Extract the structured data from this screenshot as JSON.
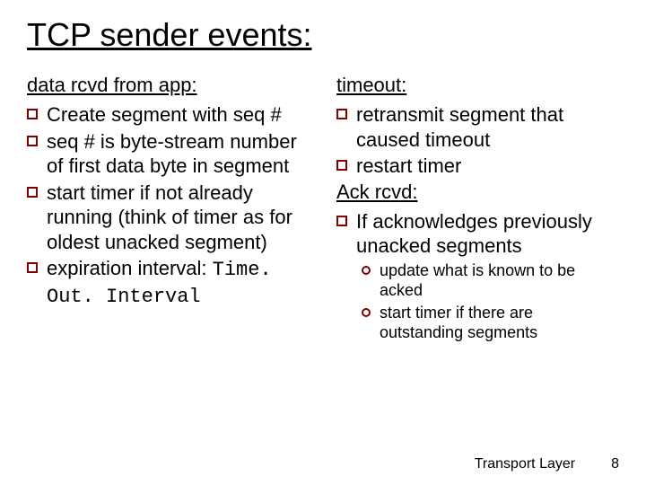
{
  "title": "TCP sender events:",
  "left": {
    "heading": "data rcvd from app:",
    "b1": "Create segment with seq #",
    "b2": "seq # is byte-stream number of first data byte in  segment",
    "b3": "start timer if not already running (think of timer as for oldest unacked segment)",
    "b4_pre": "expiration interval: ",
    "b4_code": "Time. Out. Interval"
  },
  "right": {
    "h1": "timeout:",
    "r1": "retransmit segment that caused timeout",
    "r2": "restart timer",
    "h2": "Ack rcvd:",
    "r3": "If acknowledges previously unacked segments",
    "s1": "update what is known to be acked",
    "s2": "start timer if there are outstanding segments"
  },
  "footer": {
    "label": "Transport Layer",
    "page": "8"
  }
}
